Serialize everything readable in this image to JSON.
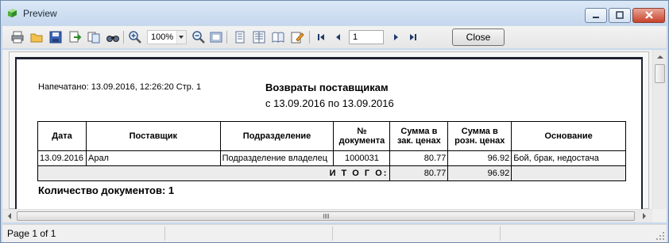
{
  "window": {
    "title": "Preview"
  },
  "toolbar": {
    "icons": [
      "print-icon",
      "open-icon",
      "save-icon",
      "export-icon",
      "copy-icon",
      "find-icon",
      "zoom-in-icon",
      "zoom-out-icon",
      "full-page-icon",
      "single-page-icon",
      "multi-page-icon",
      "book-icon",
      "edit-icon",
      "first-page-icon",
      "prev-page-icon",
      "next-page-icon",
      "last-page-icon"
    ],
    "zoom": "100%",
    "page_number": "1",
    "close_label": "Close"
  },
  "report": {
    "printed": "Напечатано: 13.09.2016, 12:26:20 Стр. 1",
    "title": "Возвраты поставщикам",
    "period": "с 13.09.2016 по 13.09.2016",
    "columns": {
      "date": "Дата",
      "supplier": "Поставщик",
      "department": "Подразделение",
      "doc_no_1": "№",
      "doc_no_2": "документа",
      "sum_purchase_1": "Сумма в",
      "sum_purchase_2": "зак. ценах",
      "sum_retail_1": "Сумма в",
      "sum_retail_2": "розн. ценах",
      "reason": "Основание"
    },
    "rows": [
      {
        "date": "13.09.2016",
        "supplier": "Арал",
        "department": "Подразделение владелец",
        "doc_no": "1000031",
        "sum_purchase": "80.77",
        "sum_retail": "96.92",
        "reason": "Бой, брак, недостача"
      }
    ],
    "total": {
      "label": "И Т О Г О:",
      "sum_purchase": "80.77",
      "sum_retail": "96.92"
    },
    "doc_count": "Количество документов: 1"
  },
  "status": {
    "text": "Page 1 of 1"
  }
}
